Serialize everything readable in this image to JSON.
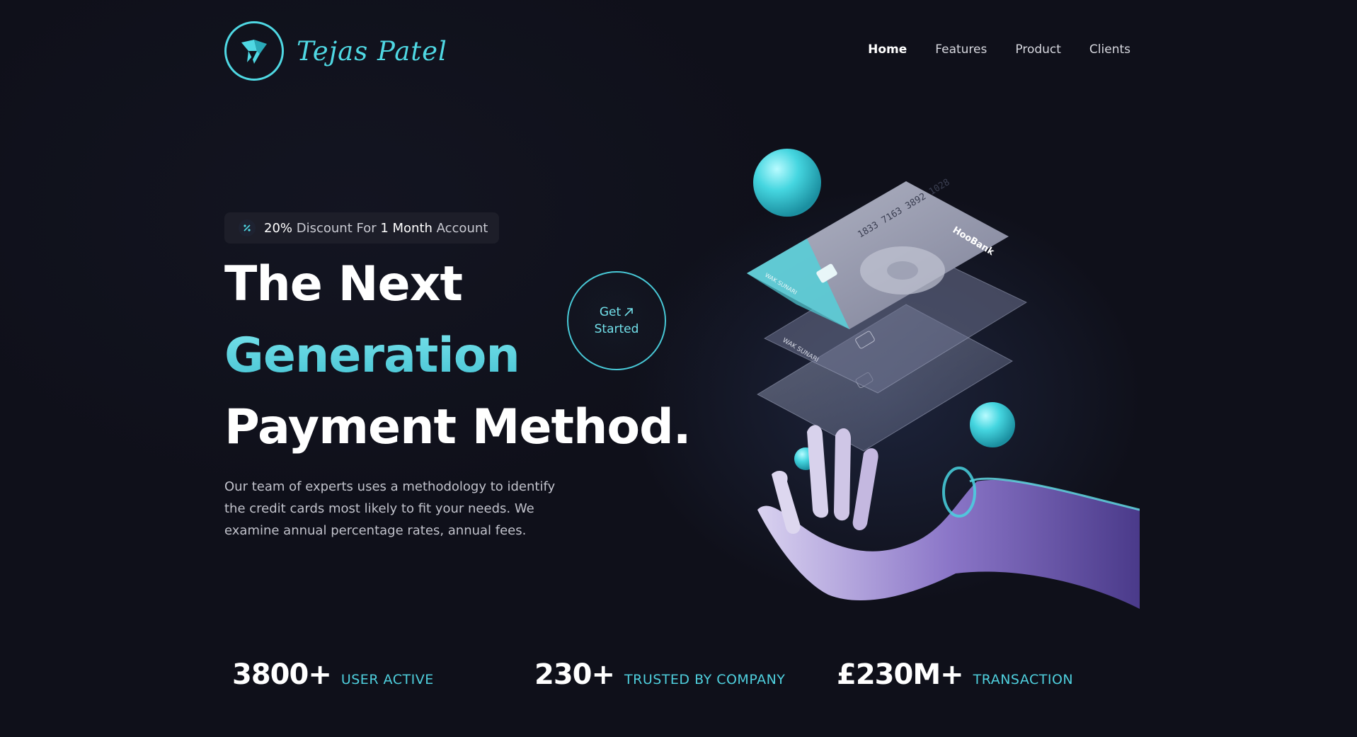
{
  "brand": {
    "name": "Tejas Patel",
    "logo_icon": "origami-bird-icon",
    "accent": "#4fd8e3"
  },
  "nav": {
    "items": [
      {
        "label": "Home",
        "active": true
      },
      {
        "label": "Features",
        "active": false
      },
      {
        "label": "Product",
        "active": false
      },
      {
        "label": "Clients",
        "active": false
      }
    ]
  },
  "promo": {
    "icon": "discount-icon",
    "percent": "20%",
    "text1": " Discount For ",
    "months": "1 Month",
    "text2": " Account"
  },
  "hero": {
    "line1": "The Next",
    "line2": "Generation",
    "line3": "Payment Method.",
    "description": "Our team of experts uses a methodology to identify the credit cards most likely to fit your needs. We examine annual percentage rates, annual fees."
  },
  "cta": {
    "line1": "Get",
    "line2": "Started",
    "icon": "arrow-up-right-icon"
  },
  "cards": {
    "number": "1833 7163 3892 1028",
    "bank": "HooBank",
    "holder": "WAK SUNARI"
  },
  "stats": [
    {
      "value": "3800+",
      "label": "USER ACTIVE"
    },
    {
      "value": "230+",
      "label": "TRUSTED BY COMPANY"
    },
    {
      "value": "£230M+",
      "label": "TRANSACTION"
    }
  ],
  "colors": {
    "background": "#0f101a",
    "accent": "#4fd8e3",
    "pill": "#1d1e29"
  }
}
